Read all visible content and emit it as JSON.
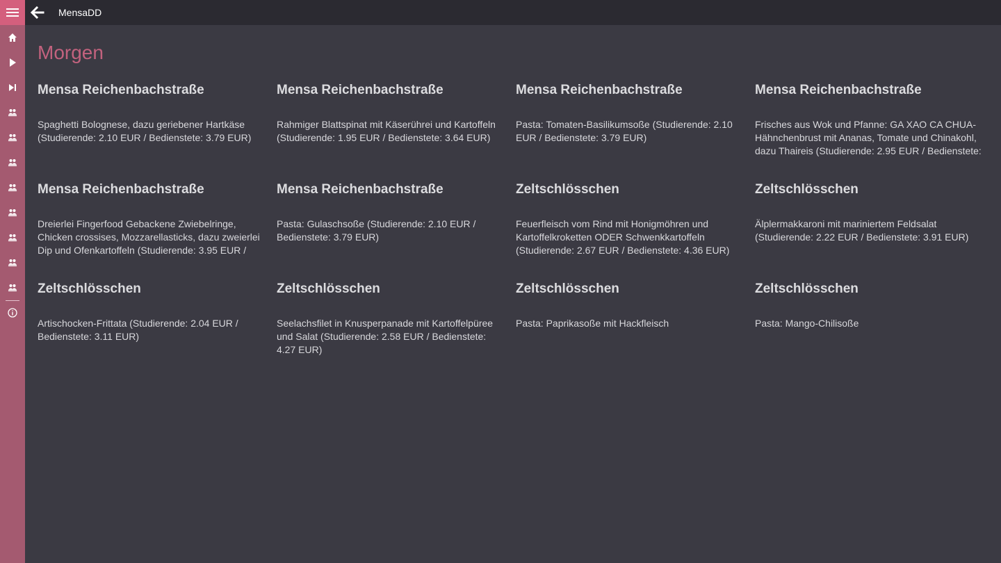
{
  "app": {
    "title": "MensaDD"
  },
  "colors": {
    "accent": "#d45f7d",
    "sidebar": "#a45a70",
    "titlebar": "#2b2a31",
    "background": "#3b3a43",
    "heading": "#c2627e"
  },
  "sidebar": {
    "icons": [
      "home-icon",
      "play-icon",
      "skip-next-icon",
      "mensa-icon",
      "mensa-icon",
      "mensa-icon",
      "mensa-icon",
      "mensa-icon",
      "mensa-icon",
      "mensa-icon",
      "mensa-icon",
      "info-icon"
    ]
  },
  "page": {
    "title": "Morgen"
  },
  "cards": [
    {
      "name": "Mensa Reichenbachstraße",
      "meal": "Spaghetti Bolognese, dazu geriebener Hartkäse (Studierende: 2.10 EUR / Bedienstete: 3.79 EUR)"
    },
    {
      "name": "Mensa Reichenbachstraße",
      "meal": "Rahmiger Blattspinat mit Käserührei und Kartoffeln (Studierende: 1.95 EUR / Bedienstete: 3.64 EUR)"
    },
    {
      "name": "Mensa Reichenbachstraße",
      "meal": "Pasta: Tomaten-Basilikumsoße (Studierende: 2.10 EUR / Bedienstete: 3.79 EUR)"
    },
    {
      "name": "Mensa Reichenbachstraße",
      "meal": "Frisches aus Wok und Pfanne: GA XAO CA CHUA- Hähnchenbrust mit Ananas, Tomate und Chinakohl, dazu Thaireis (Studierende: 2.95 EUR / Bedienstete:"
    },
    {
      "name": "Mensa Reichenbachstraße",
      "meal": "Dreierlei Fingerfood Gebackene Zwiebelringe, Chicken crossises, Mozzarellasticks, dazu zweierlei Dip und Ofenkartoffeln (Studierende: 3.95 EUR /"
    },
    {
      "name": "Mensa Reichenbachstraße",
      "meal": "Pasta: Gulaschsoße (Studierende: 2.10 EUR / Bedienstete: 3.79 EUR)"
    },
    {
      "name": "Zeltschlösschen",
      "meal": "Feuerfleisch vom Rind mit Honigmöhren und Kartoffelkroketten ODER Schwenkkartoffeln (Studierende: 2.67 EUR / Bedienstete: 4.36 EUR)"
    },
    {
      "name": "Zeltschlösschen",
      "meal": "Älplermakkaroni mit mariniertem Feldsalat (Studierende: 2.22 EUR / Bedienstete: 3.91 EUR)"
    },
    {
      "name": "Zeltschlösschen",
      "meal": "Artischocken-Frittata (Studierende: 2.04 EUR / Bedienstete: 3.11 EUR)"
    },
    {
      "name": "Zeltschlösschen",
      "meal": "Seelachsfilet in Knusperpanade mit Kartoffelpüree und Salat (Studierende: 2.58 EUR / Bedienstete: 4.27 EUR)"
    },
    {
      "name": "Zeltschlösschen",
      "meal": "Pasta: Paprikasoße mit Hackfleisch"
    },
    {
      "name": "Zeltschlösschen",
      "meal": "Pasta: Mango-Chilisoße"
    }
  ]
}
